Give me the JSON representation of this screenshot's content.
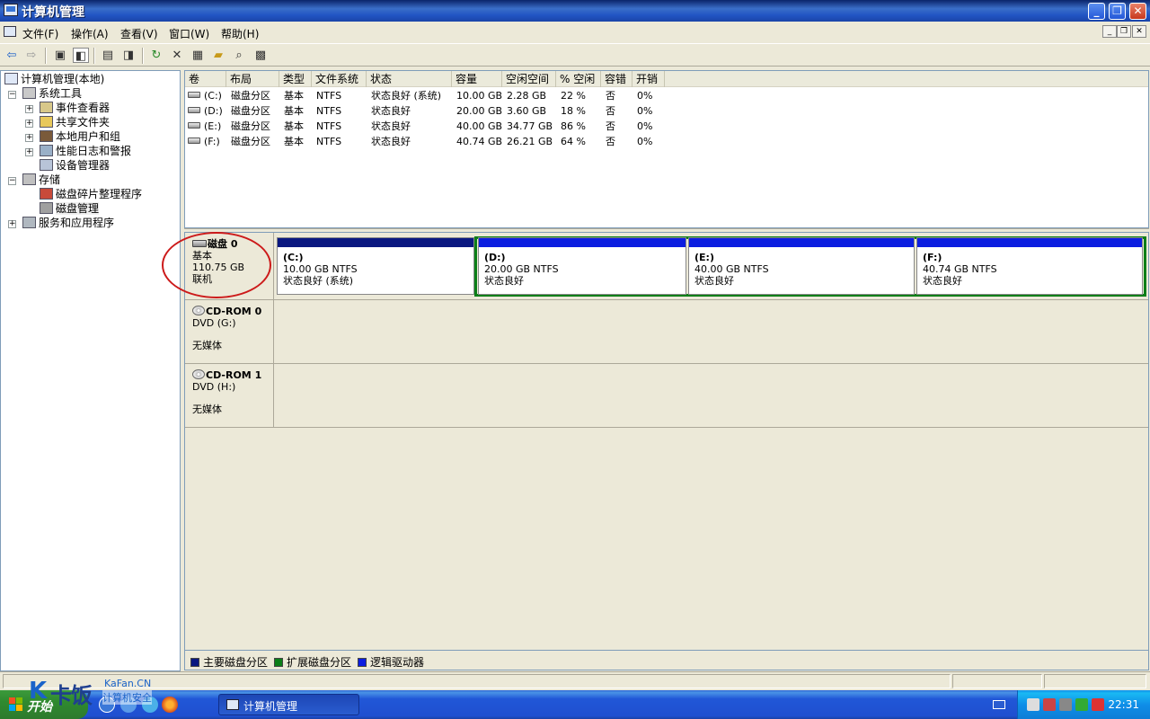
{
  "window": {
    "title": "计算机管理"
  },
  "menu": [
    "文件(F)",
    "操作(A)",
    "查看(V)",
    "窗口(W)",
    "帮助(H)"
  ],
  "tree": {
    "root": "计算机管理(本地)",
    "system_tools": "系统工具",
    "event_viewer": "事件查看器",
    "shared_folders": "共享文件夹",
    "local_users": "本地用户和组",
    "perf_logs": "性能日志和警报",
    "device_manager": "设备管理器",
    "storage": "存储",
    "defrag": "磁盘碎片整理程序",
    "disk_mgmt": "磁盘管理",
    "services": "服务和应用程序"
  },
  "volumes": {
    "columns": [
      "卷",
      "布局",
      "类型",
      "文件系统",
      "状态",
      "容量",
      "空闲空间",
      "% 空闲",
      "容错",
      "开销"
    ],
    "rows": [
      [
        "(C:)",
        "磁盘分区",
        "基本",
        "NTFS",
        "状态良好 (系统)",
        "10.00 GB",
        "2.28 GB",
        "22 %",
        "否",
        "0%"
      ],
      [
        "(D:)",
        "磁盘分区",
        "基本",
        "NTFS",
        "状态良好",
        "20.00 GB",
        "3.60 GB",
        "18 %",
        "否",
        "0%"
      ],
      [
        "(E:)",
        "磁盘分区",
        "基本",
        "NTFS",
        "状态良好",
        "40.00 GB",
        "34.77 GB",
        "86 %",
        "否",
        "0%"
      ],
      [
        "(F:)",
        "磁盘分区",
        "基本",
        "NTFS",
        "状态良好",
        "40.74 GB",
        "26.21 GB",
        "64 %",
        "否",
        "0%"
      ]
    ]
  },
  "disk0": {
    "name": "磁盘 0",
    "type": "基本",
    "size": "110.75 GB",
    "status": "联机",
    "partitions": [
      {
        "name": "(C:)",
        "size": "10.00 GB NTFS",
        "status": "状态良好 (系统)"
      },
      {
        "name": "(D:)",
        "size": "20.00 GB NTFS",
        "status": "状态良好"
      },
      {
        "name": "(E:)",
        "size": "40.00 GB NTFS",
        "status": "状态良好"
      },
      {
        "name": "(F:)",
        "size": "40.74 GB NTFS",
        "status": "状态良好"
      }
    ]
  },
  "cdrom0": {
    "name": "CD-ROM 0",
    "drive": "DVD (G:)",
    "media": "无媒体"
  },
  "cdrom1": {
    "name": "CD-ROM 1",
    "drive": "DVD (H:)",
    "media": "无媒体"
  },
  "legend": {
    "primary": "主要磁盘分区",
    "extended": "扩展磁盘分区",
    "logical": "逻辑驱动器",
    "colors": {
      "primary": "#0a1880",
      "extended": "#0b7e18",
      "logical": "#0b1de0"
    }
  },
  "taskbar": {
    "start": "开始",
    "task": "计算机管理",
    "clock": "22:31"
  },
  "watermark": {
    "en": "KaFan.CN",
    "cn": "计算机安全",
    "logo_k": "K",
    "logo_text": "卡饭"
  }
}
